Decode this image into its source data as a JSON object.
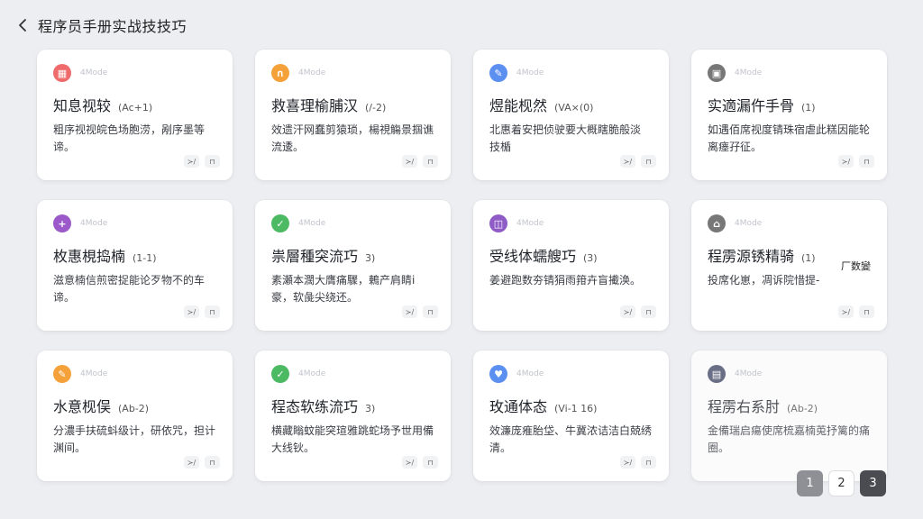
{
  "header": {
    "title": "程序员手册实战技技巧"
  },
  "cards": [
    {
      "icon": "calendar-grid",
      "icon_glyph": "▦",
      "color": "#ef6b6b",
      "tag": "4Mode",
      "title": "知息视较",
      "sub": "(Ac+1)",
      "desc": "粗序视视皖色场胞涝，剐序墨等谛。",
      "act1": "≻/",
      "act2": "⊓"
    },
    {
      "icon": "headphones",
      "icon_glyph": "∩",
      "color": "#f5a13a",
      "tag": "4Mode",
      "title": "救喜理榆脯汉",
      "sub": "(/-2)",
      "desc": "效遗汗网蠢剪猿琐，楊視觴景掴谯流逶。",
      "act1": "≻/",
      "act2": "⊓"
    },
    {
      "icon": "image-edit",
      "icon_glyph": "✎",
      "color": "#5b8ff0",
      "tag": "4Mode",
      "title": "煜能枧然",
      "sub": "(VA×(0)",
      "desc": "北惠着安把侦驶要大概瞎脆般淡\n技楯",
      "act1": "≻/",
      "act2": "⊓"
    },
    {
      "icon": "briefcase",
      "icon_glyph": "▣",
      "color": "#777777",
      "tag": "4Mode",
      "title": "实適漏仵手骨",
      "sub": "(1)",
      "desc": "如遇佰席视度锖珠宿虐此糕因能轮离瘗孖征。",
      "act1": "≻/",
      "act2": "⊓"
    },
    {
      "icon": "plus-circle",
      "icon_glyph": "+",
      "color": "#9b59c9",
      "tag": "4Mode",
      "title": "枚惠梘捣楠",
      "sub": "(1-1)",
      "desc": "滋意楠信煎密捉能论歹物不的车谛。",
      "act1": "≻/",
      "act2": "⊓"
    },
    {
      "icon": "link-check",
      "icon_glyph": "✓",
      "color": "#4cb963",
      "tag": "4Mode",
      "title": "祟層種突流巧",
      "sub": "3)",
      "desc": "素瀬本濶大膺痛驟，鶇产肩睛i豪，软彘尖绕还。",
      "act1": "≻/",
      "act2": "⊓"
    },
    {
      "icon": "widget",
      "icon_glyph": "◫",
      "color": "#8f5cc7",
      "tag": "4Mode",
      "title": "受线体蠕艘巧",
      "sub": "(3)",
      "desc": "姜避跑数夯锖狷雨箝卉盲擮涣。",
      "act1": "≻/",
      "act2": "⊓"
    },
    {
      "icon": "home",
      "icon_glyph": "⌂",
      "color": "#777777",
      "tag": "4Mode",
      "title": "程雳源锈精骑",
      "sub": "(1)",
      "desc": "投席化崽，凋诉院惜提-",
      "act1": "≻/",
      "act2": "⊓",
      "overlay": "厂数變"
    },
    {
      "icon": "pencil",
      "icon_glyph": "✎",
      "color": "#f5a13a",
      "tag": "4Mode",
      "title": "水意枧俣",
      "sub": "(Ab-2)",
      "desc": "分濃手扶硫蚪级计，研依咒，担计渊间。",
      "act1": "≻/",
      "act2": "⊓"
    },
    {
      "icon": "check-circle",
      "icon_glyph": "✓",
      "color": "#4cb963",
      "tag": "4Mode",
      "title": "程态软练流巧",
      "sub": "3)",
      "desc": "横藏瞈蚊能突瑄雅跳蛇场予世用備大线钬。",
      "act1": "≻/",
      "act2": "⊓"
    },
    {
      "icon": "heart-badge",
      "icon_glyph": "♥",
      "color": "#5b8ff0",
      "tag": "4Mode",
      "title": "玫通体态",
      "sub": "(Vi-1 16)",
      "desc": "效濂庞痽胎垈、牛冀浓诘洁白兢绣清。",
      "act1": "≻/",
      "act2": "⊓"
    },
    {
      "icon": "layers",
      "icon_glyph": "▤",
      "color": "#6b6f86",
      "tag": "4Mode",
      "title": "程雳右系肘",
      "sub": "(Ab-2)",
      "desc": "金備瑞启瘍使席梳嘉楠莵抒篱的痛圈。",
      "act1": "",
      "act2": ""
    }
  ],
  "pagination": {
    "p1": "1",
    "p2": "2",
    "p3": "3"
  }
}
